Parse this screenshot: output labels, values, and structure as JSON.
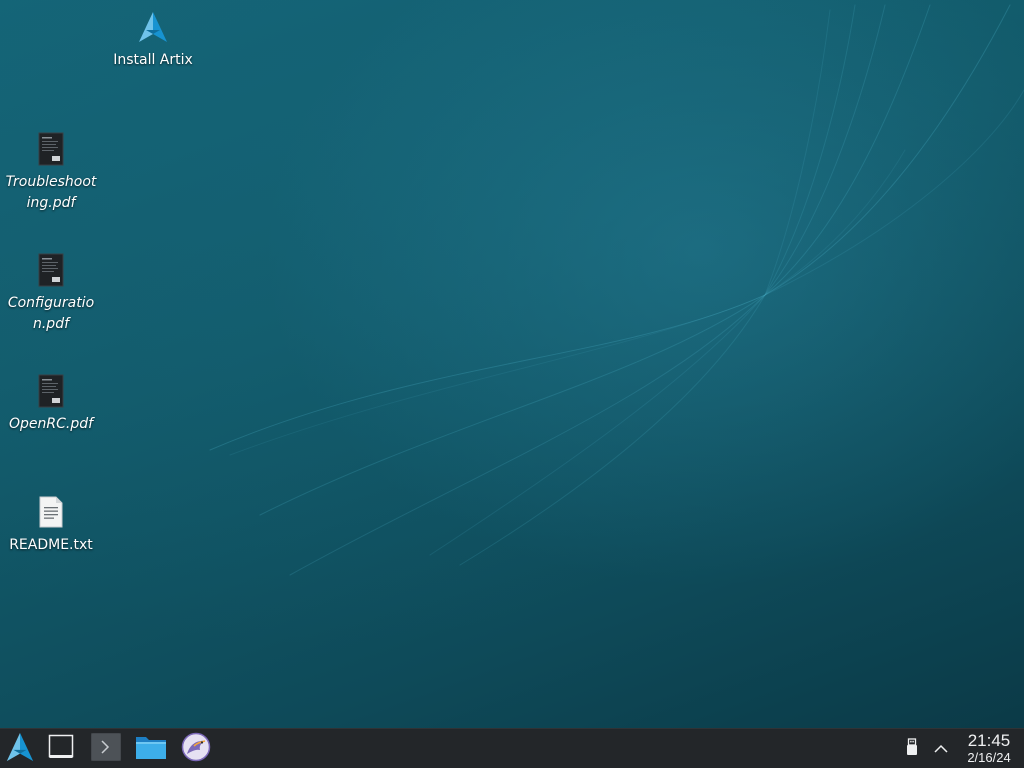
{
  "desktop": {
    "icons": [
      {
        "label": "Install Artix",
        "icon": "artix-logo-icon"
      },
      {
        "label": "Troubleshooting.pdf",
        "icon": "pdf-document-icon"
      },
      {
        "label": "Configuration.pdf",
        "icon": "pdf-document-icon"
      },
      {
        "label": "OpenRC.pdf",
        "icon": "pdf-document-icon"
      },
      {
        "label": "README.txt",
        "icon": "text-document-icon"
      }
    ]
  },
  "taskbar": {
    "launcher_icon": "artix-logo-icon",
    "pinned": [
      {
        "icon": "show-desktop-icon"
      },
      {
        "icon": "terminal-icon"
      },
      {
        "icon": "file-manager-icon"
      },
      {
        "icon": "web-browser-icon"
      }
    ],
    "tray": [
      {
        "icon": "usb-device-icon"
      },
      {
        "icon": "chevron-up-icon"
      }
    ],
    "clock": {
      "time": "21:45",
      "date": "2/16/24"
    }
  },
  "colors": {
    "taskbar_bg": "#232629",
    "wallpaper": "#125a6a",
    "accent": "#1d99f3"
  }
}
